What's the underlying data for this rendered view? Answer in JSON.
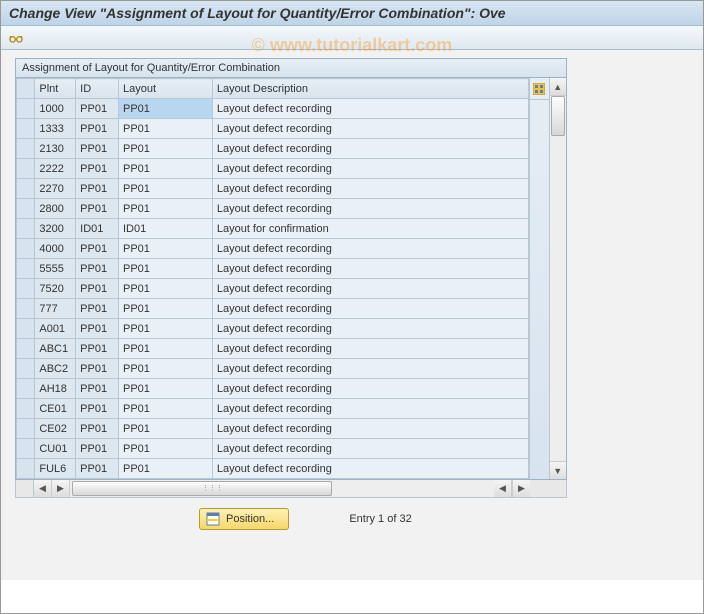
{
  "title": "Change View \"Assignment of Layout for Quantity/Error Combination\": Ove",
  "watermark": "© www.tutorialkart.com",
  "panel": {
    "title": "Assignment of Layout for Quantity/Error Combination"
  },
  "columns": {
    "plnt": "Plnt",
    "id": "ID",
    "layout": "Layout",
    "desc": "Layout Description"
  },
  "rows": [
    {
      "plnt": "1000",
      "id": "PP01",
      "layout": "PP01",
      "desc": "Layout defect recording",
      "sel": true
    },
    {
      "plnt": "1333",
      "id": "PP01",
      "layout": "PP01",
      "desc": "Layout defect recording"
    },
    {
      "plnt": "2130",
      "id": "PP01",
      "layout": "PP01",
      "desc": "Layout defect recording"
    },
    {
      "plnt": "2222",
      "id": "PP01",
      "layout": "PP01",
      "desc": "Layout defect recording"
    },
    {
      "plnt": "2270",
      "id": "PP01",
      "layout": "PP01",
      "desc": "Layout defect recording"
    },
    {
      "plnt": "2800",
      "id": "PP01",
      "layout": "PP01",
      "desc": "Layout defect recording"
    },
    {
      "plnt": "3200",
      "id": "ID01",
      "layout": "ID01",
      "desc": "Layout for confirmation"
    },
    {
      "plnt": "4000",
      "id": "PP01",
      "layout": "PP01",
      "desc": "Layout defect recording"
    },
    {
      "plnt": "5555",
      "id": "PP01",
      "layout": "PP01",
      "desc": "Layout defect recording"
    },
    {
      "plnt": "7520",
      "id": "PP01",
      "layout": "PP01",
      "desc": "Layout defect recording"
    },
    {
      "plnt": "777",
      "id": "PP01",
      "layout": "PP01",
      "desc": "Layout defect recording"
    },
    {
      "plnt": "A001",
      "id": "PP01",
      "layout": "PP01",
      "desc": "Layout defect recording"
    },
    {
      "plnt": "ABC1",
      "id": "PP01",
      "layout": "PP01",
      "desc": "Layout defect recording"
    },
    {
      "plnt": "ABC2",
      "id": "PP01",
      "layout": "PP01",
      "desc": "Layout defect recording"
    },
    {
      "plnt": "AH18",
      "id": "PP01",
      "layout": "PP01",
      "desc": "Layout defect recording"
    },
    {
      "plnt": "CE01",
      "id": "PP01",
      "layout": "PP01",
      "desc": "Layout defect recording"
    },
    {
      "plnt": "CE02",
      "id": "PP01",
      "layout": "PP01",
      "desc": "Layout defect recording"
    },
    {
      "plnt": "CU01",
      "id": "PP01",
      "layout": "PP01",
      "desc": "Layout defect recording"
    },
    {
      "plnt": "FUL6",
      "id": "PP01",
      "layout": "PP01",
      "desc": "Layout defect recording"
    }
  ],
  "footer": {
    "position_button": "Position...",
    "entry_status": "Entry 1 of 32"
  }
}
